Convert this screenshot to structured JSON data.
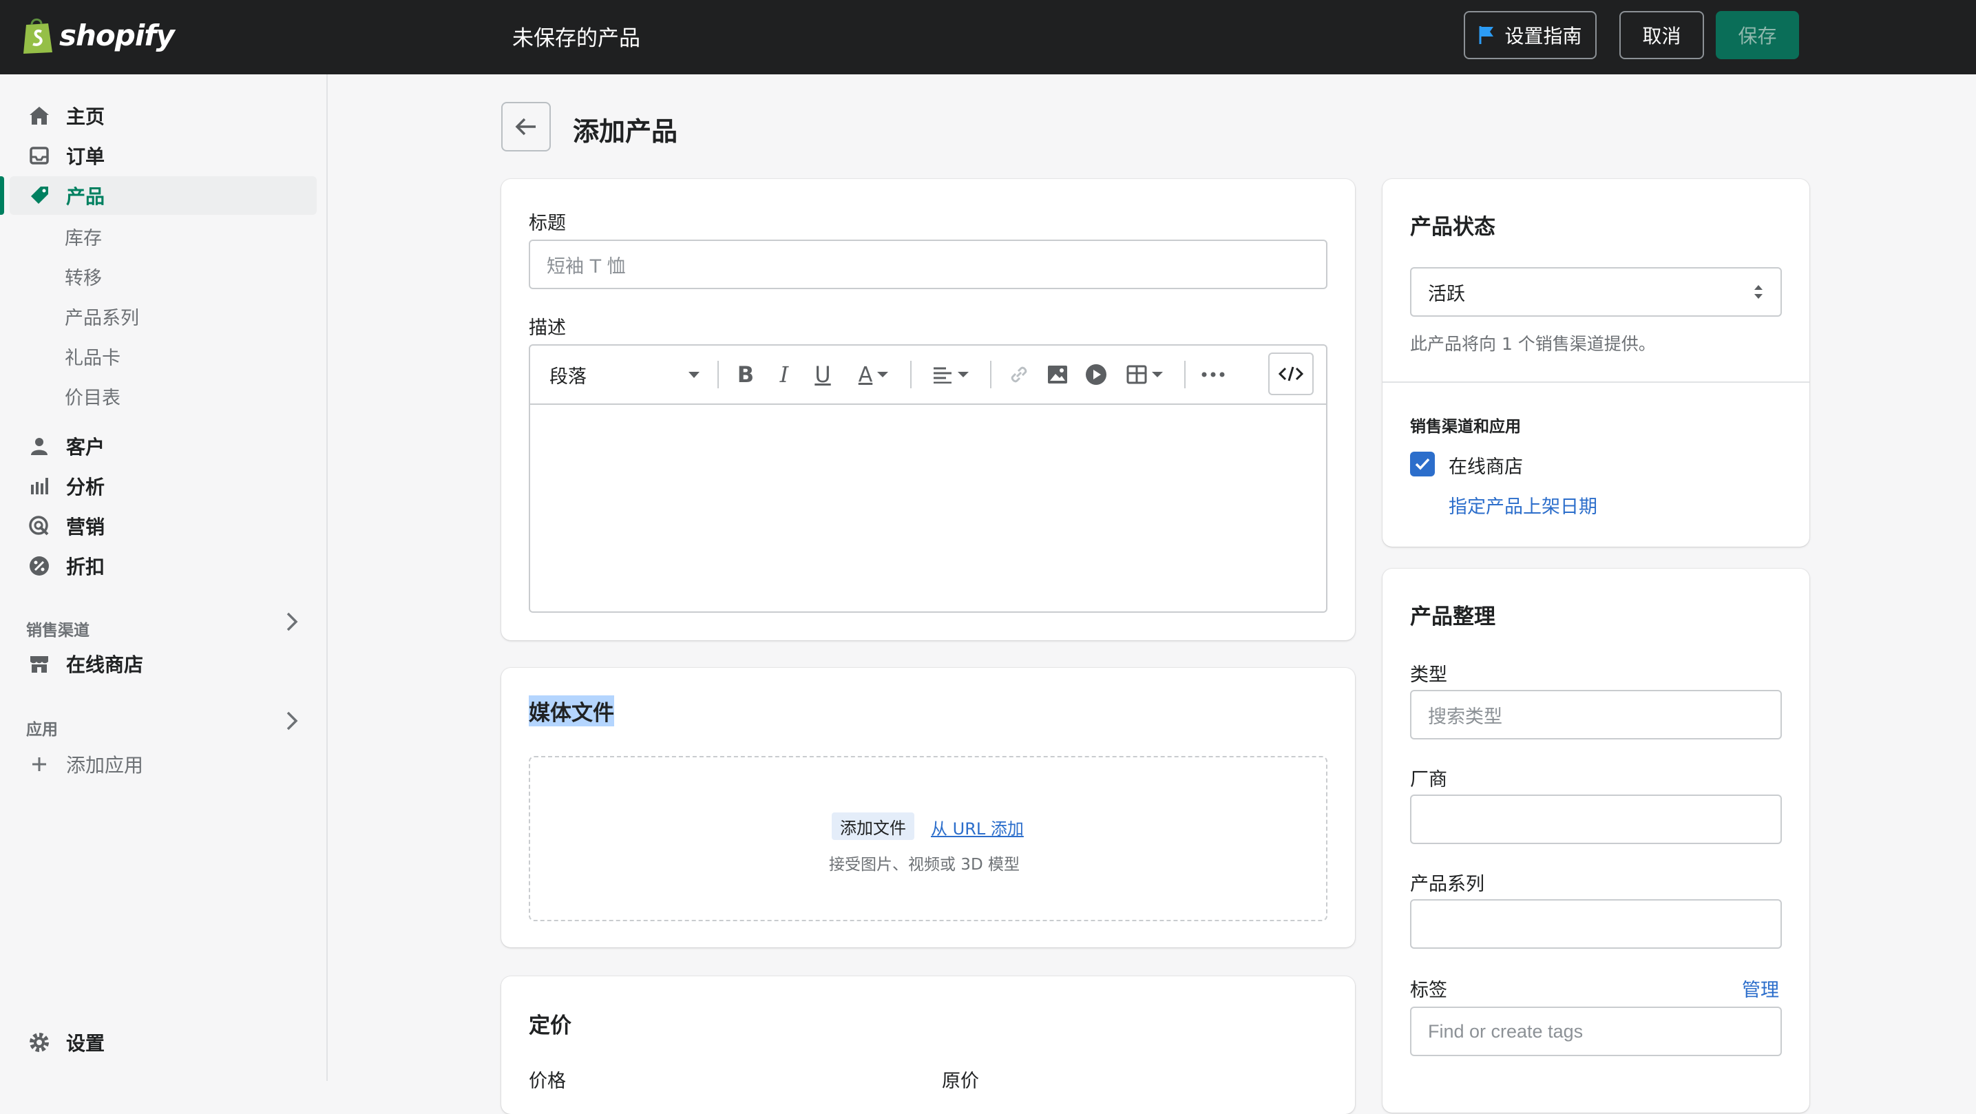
{
  "topbar": {
    "brand": "shopify",
    "page_title": "未保存的产品",
    "setup_label": "设置指南",
    "cancel_label": "取消",
    "save_label": "保存"
  },
  "sidebar": {
    "items": [
      {
        "label": "主页",
        "icon": "home-icon"
      },
      {
        "label": "订单",
        "icon": "inbox-icon"
      },
      {
        "label": "产品",
        "icon": "tag-icon"
      },
      {
        "label": "客户",
        "icon": "person-icon"
      },
      {
        "label": "分析",
        "icon": "bar-chart-icon"
      },
      {
        "label": "营销",
        "icon": "target-icon"
      },
      {
        "label": "折扣",
        "icon": "discount-icon"
      }
    ],
    "product_sub": [
      "库存",
      "转移",
      "产品系列",
      "礼品卡",
      "价目表"
    ],
    "sales_channels_label": "销售渠道",
    "online_store": "在线商店",
    "apps_label": "应用",
    "add_app": "添加应用",
    "settings": "设置"
  },
  "main": {
    "title": "添加产品",
    "title_label": "标题",
    "title_placeholder": "短袖 T 恤",
    "description_label": "描述",
    "paragraph_select": "段落",
    "media": {
      "title": "媒体文件",
      "add_file": "添加文件",
      "add_from_url": "从 URL 添加",
      "hint": "接受图片、视频或 3D 模型"
    },
    "pricing": {
      "title": "定价",
      "price_label": "价格",
      "compare_label": "原价"
    }
  },
  "status_card": {
    "title": "产品状态",
    "value": "活跃",
    "note": "此产品将向 1 个销售渠道提供。",
    "channels_label": "销售渠道和应用",
    "online_store": "在线商店",
    "online_store_checked": true,
    "schedule_link": "指定产品上架日期"
  },
  "org_card": {
    "title": "产品整理",
    "type_label": "类型",
    "type_placeholder": "搜索类型",
    "vendor_label": "厂商",
    "collection_label": "产品系列",
    "tags_label": "标签",
    "manage_link": "管理",
    "tags_placeholder": "Find or create tags"
  },
  "colors": {
    "topbar": "#1f2021",
    "accent_green": "#008060",
    "link_blue": "#2c6ecb",
    "save_disabled": "#0a6e58"
  }
}
